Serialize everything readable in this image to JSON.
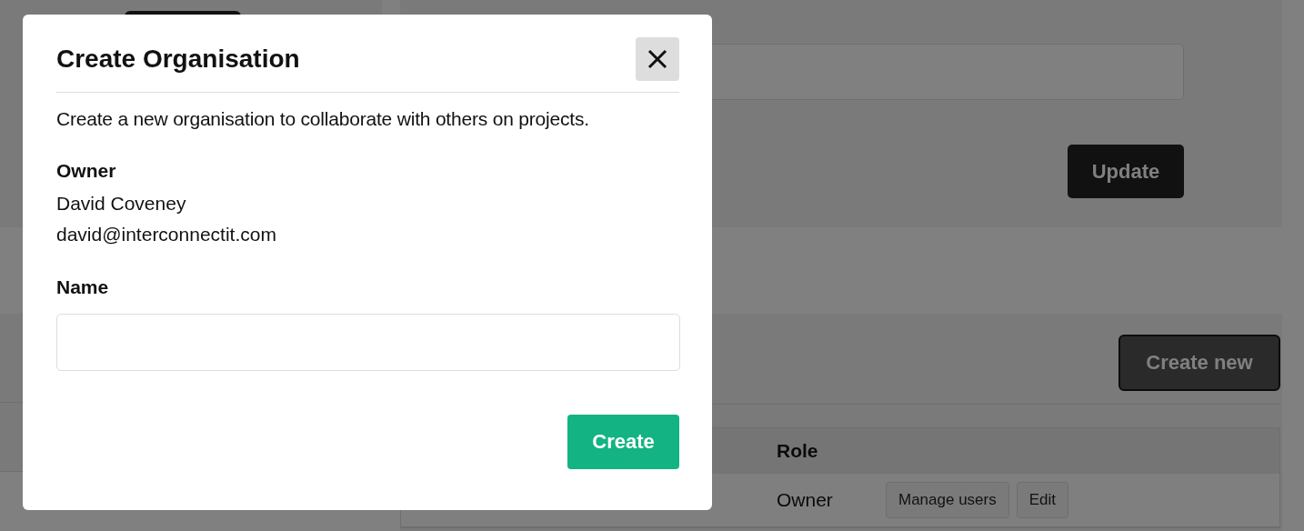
{
  "page": {
    "update_button": "Update",
    "create_new_button": "Create new",
    "table": {
      "columns": [
        "Role"
      ],
      "rows": [
        {
          "role": "Owner",
          "actions": [
            "Manage users",
            "Edit"
          ]
        }
      ]
    }
  },
  "dialog": {
    "title": "Create Organisation",
    "description": "Create a new organisation to collaborate with others on projects.",
    "owner_label": "Owner",
    "owner_name": "David Coveney",
    "owner_email": "david@interconnectit.com",
    "name_label": "Name",
    "submit_button": "Create"
  }
}
